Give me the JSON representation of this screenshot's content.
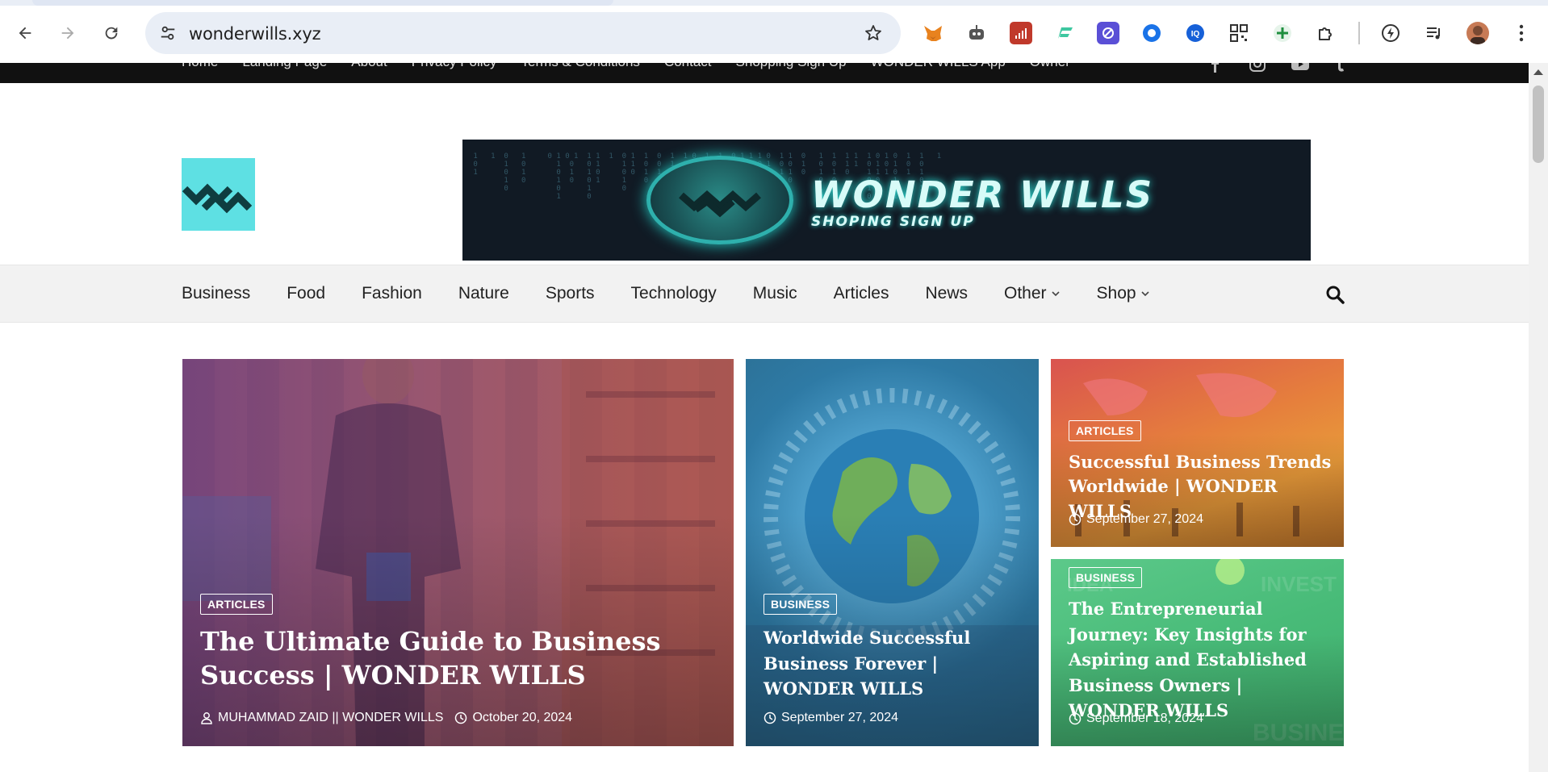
{
  "browser": {
    "url": "wonderwills.xyz",
    "extensions": [
      "fox-icon",
      "robot-icon",
      "signal-icon",
      "flag-icon",
      "shield-icon",
      "circle-record-icon",
      "iq-icon",
      "qr-icon",
      "plus-icon",
      "puzzle-icon"
    ],
    "right_icons": [
      "bolt-icon",
      "playlist-icon",
      "avatar",
      "kebab-menu-icon"
    ]
  },
  "topbar": {
    "links": [
      "Home",
      "Landing Page",
      "About",
      "Privacy Policy",
      "Terms & Conditions",
      "Contact",
      "Shopping Sign Up",
      "WONDER WILLS App",
      "Owner"
    ],
    "social": [
      "facebook-icon",
      "instagram-icon",
      "youtube-icon",
      "tumblr-icon"
    ]
  },
  "banner": {
    "title": "WONDER WILLS",
    "subtitle": "SHOPING SIGN UP"
  },
  "nav": {
    "items": [
      {
        "label": "Business",
        "dropdown": false
      },
      {
        "label": "Food",
        "dropdown": false
      },
      {
        "label": "Fashion",
        "dropdown": false
      },
      {
        "label": "Nature",
        "dropdown": false
      },
      {
        "label": "Sports",
        "dropdown": false
      },
      {
        "label": "Technology",
        "dropdown": false
      },
      {
        "label": "Music",
        "dropdown": false
      },
      {
        "label": "Articles",
        "dropdown": false
      },
      {
        "label": "News",
        "dropdown": false
      },
      {
        "label": "Other",
        "dropdown": true
      },
      {
        "label": "Shop",
        "dropdown": true
      }
    ]
  },
  "posts": {
    "main": {
      "category": "ARTICLES",
      "title": "The Ultimate Guide to Business Success | WONDER WILLS",
      "author": "MUHAMMAD ZAID || WONDER WILLS",
      "date": "October 20, 2024"
    },
    "middle": {
      "category": "BUSINESS",
      "title": "Worldwide Successful Business Forever | WONDER WILLS",
      "date": "September 27, 2024"
    },
    "top_right": {
      "category": "ARTICLES",
      "title": "Successful Business Trends Worldwide | WONDER WILLS",
      "date": "September 27, 2024"
    },
    "bottom_right": {
      "category": "BUSINESS",
      "title": "The Entrepreneurial Journey: Key Insights for Aspiring and Established Business Owners | WONDER WILLS",
      "date": "September 18, 2024"
    }
  },
  "colors": {
    "logo_bg": "#5ee0e3",
    "topbar_bg": "#111111",
    "nav_bg": "#f2f2f2"
  }
}
